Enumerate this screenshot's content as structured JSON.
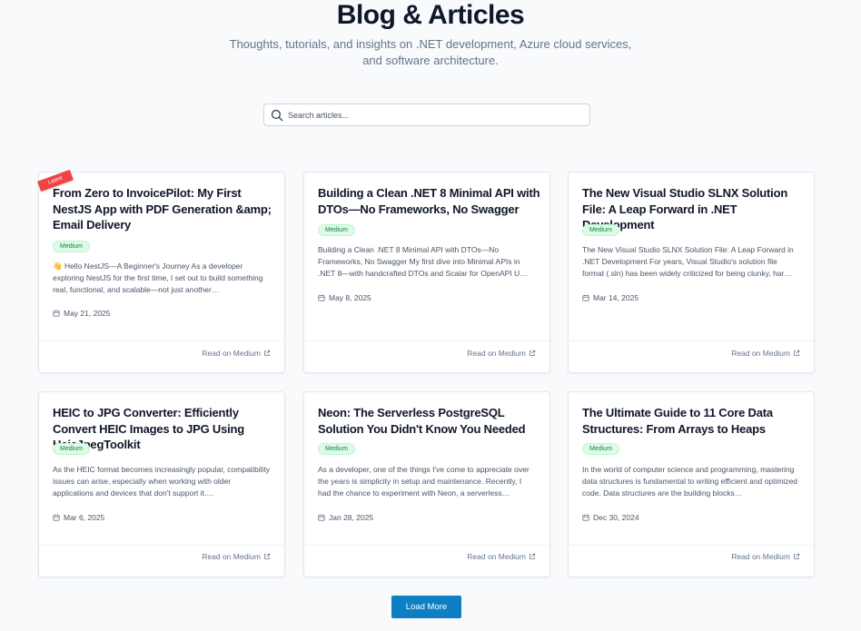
{
  "header": {
    "title": "Blog & Articles",
    "subtitle": "Thoughts, tutorials, and insights on .NET development, Azure cloud services, and software architecture."
  },
  "search": {
    "placeholder": "Search articles..."
  },
  "latest_label": "Latest",
  "read_label": "Read on Medium",
  "articles": [
    {
      "title": "From Zero to InvoicePilot: My First NestJS App with PDF Generation &amp; Email Delivery",
      "tag": "Medium",
      "excerpt": "👋 Hello NestJS—A Beginner's Journey As a developer exploring NestJS for the first time, I set out to build something real, functional, and scalable—not just another…",
      "date": "May 21, 2025"
    },
    {
      "title": "Building a Clean .NET 8 Minimal API with DTOs—No Frameworks, No Swagger",
      "tag": "Medium",
      "excerpt": "Building a Clean .NET 8 Minimal API with DTOs—No Frameworks, No Swagger My first dive into Minimal APIs in .NET 8—with handcrafted DTOs and Scalar for OpenAPI U…",
      "date": "May 8, 2025"
    },
    {
      "title": "The New Visual Studio SLNX Solution File: A Leap Forward in .NET Development",
      "tag": "Medium",
      "excerpt": "The New Visual Studio SLNX Solution File: A Leap Forward in .NET Development For years, Visual Studio's solution file format (.sln) has been widely criticized for being clunky, har…",
      "date": "Mar 14, 2025"
    },
    {
      "title": "HEIC to JPG Converter: Efficiently Convert HEIC Images to JPG Using HeicJpegToolkit",
      "tag": "Medium",
      "excerpt": "As the HEIC format becomes increasingly popular, compatibility issues can arise, especially when working with older applications and devices that don't support it.…",
      "date": "Mar 6, 2025"
    },
    {
      "title": "Neon: The Serverless PostgreSQL Solution You Didn't Know You Needed",
      "tag": "Medium",
      "excerpt": "As a developer, one of the things I've come to appreciate over the years is simplicity in setup and maintenance. Recently, I had the chance to experiment with Neon, a serverless…",
      "date": "Jan 28, 2025"
    },
    {
      "title": "The Ultimate Guide to 11 Core Data Structures: From Arrays to Heaps",
      "tag": "Medium",
      "excerpt": "In the world of computer science and programming, mastering data structures is fundamental to writing efficient and optimized code. Data structures are the building blocks…",
      "date": "Dec 30, 2024"
    }
  ],
  "load_more_label": "Load More",
  "colors": {
    "accent": "#0f7fc4",
    "badge_bg": "#dcfce7",
    "badge_text": "#15803d",
    "ribbon": "#ef4444"
  },
  "icons": {
    "search": "search-icon",
    "date": "calendar-icon",
    "link": "external-link-icon"
  }
}
